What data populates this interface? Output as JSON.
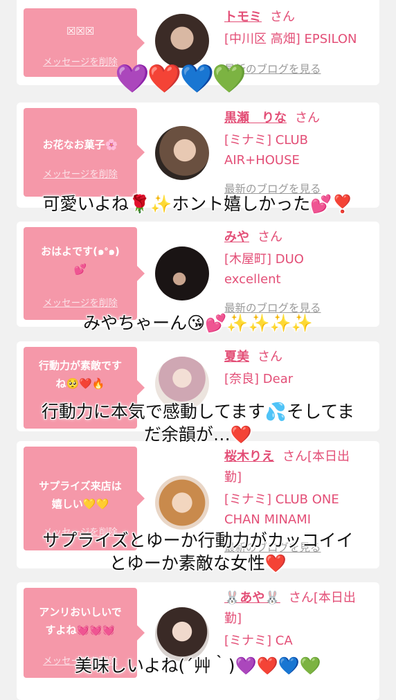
{
  "delete_label": "メッセージを削除",
  "blog_label": "最新のブログを見る",
  "san": "さん",
  "cards": [
    {
      "message": "☒☒☒",
      "name": "トモミ",
      "san": "さん",
      "address": "[中川区 高畑] EPSILON"
    },
    {
      "message": "お花なお菓子🌸",
      "name": "黒瀬　りな",
      "san": "さん",
      "address_1": "[ミナミ] CLUB",
      "address_2": "AIR+HOUSE"
    },
    {
      "message_1": "おはよです(๑ᐤ๑)",
      "message_2": "💕",
      "name": "みや",
      "san": "さん",
      "address_1": "[木屋町] DUO",
      "address_2": "excellent"
    },
    {
      "message_1": "行動力が素敵です",
      "message_2": "ね🥺❤️🔥",
      "name": "夏美",
      "san": "さん",
      "address": "[奈良] Dear"
    },
    {
      "message_1": "サプライズ来店は",
      "message_2": "嬉しい💛💛",
      "name": "桜木りえ",
      "san": "さん[本日出",
      "san_2": "勤]",
      "address_1": "[ミナミ] CLUB ONE",
      "address_2": "CHAN MINAMI"
    },
    {
      "message_1": "アンリおいしいで",
      "message_2": "すよね💓💓💓",
      "name": "🐰あや🐰",
      "san": "さん[本日出",
      "san_2": "勤]",
      "address": "[ミナミ] CA"
    }
  ],
  "overlays": {
    "hearts_top": "💜❤️💙💚",
    "line1": "可愛いよね🌹✨ホント嬉しかった💕❣️",
    "line2": "みやちゃーん😘💕✨✨✨✨",
    "line3a": "行動力に本気で感動してます💦そしてま",
    "line3b": "だ余韻が…❤️",
    "line4a": "サプライズとゆーか行動力がカッコイイ",
    "line4b": "とゆーか素敵な女性❤️",
    "line5": "美味しいよね(´艸｀)💜❤️💙💚"
  },
  "colors": {
    "accent": "#e34f77",
    "bubble": "#f598a9",
    "background": "#f1f1f1",
    "link_gray": "#9a9a9a"
  },
  "avatar_icons": [
    "avatar-tomomi",
    "avatar-rina",
    "avatar-miya",
    "avatar-natsumi",
    "avatar-rie",
    "avatar-aya"
  ]
}
